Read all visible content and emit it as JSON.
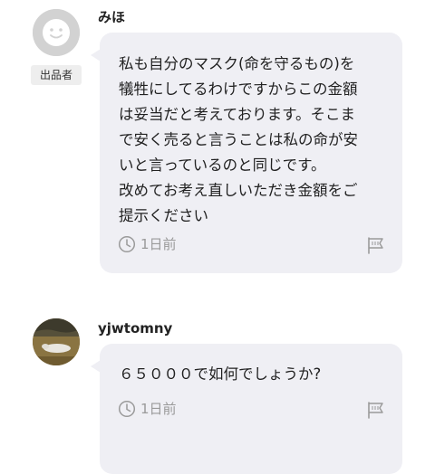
{
  "comments": [
    {
      "username": "みほ",
      "badge": "出品者",
      "avatar": "default-user-icon",
      "text": "私も自分のマスク(命を守るもの)を\n犠牲にしてるわけですからこの金額\nは妥当だと考えております。そこま\nで安く売ると言うことは私の命が安\nいと言っているのと同じです。\n改めてお考え直しいただき金額をご\n提示ください",
      "time": "1日前"
    },
    {
      "username": "yjwtomny",
      "avatar": "user-photo",
      "text": "６５０００で如何でしょうか?",
      "time": "1日前"
    }
  ],
  "colors": {
    "bubble": "#efeff4",
    "meta": "#9a9a9a",
    "text": "#222222"
  }
}
